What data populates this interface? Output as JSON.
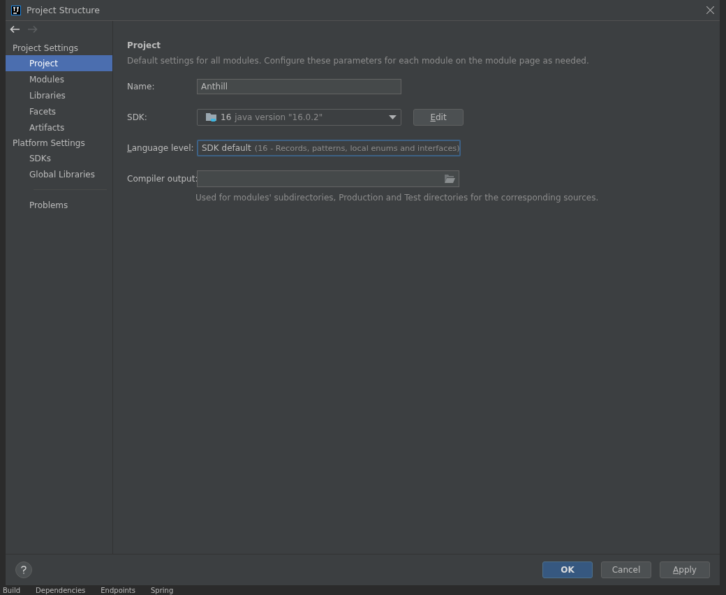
{
  "window": {
    "title": "Project Structure"
  },
  "sidebar": {
    "groups": [
      {
        "heading": "Project Settings",
        "items": [
          {
            "label": "Project",
            "selected": true
          },
          {
            "label": "Modules",
            "selected": false
          },
          {
            "label": "Libraries",
            "selected": false
          },
          {
            "label": "Facets",
            "selected": false
          },
          {
            "label": "Artifacts",
            "selected": false
          }
        ]
      },
      {
        "heading": "Platform Settings",
        "items": [
          {
            "label": "SDKs",
            "selected": false
          },
          {
            "label": "Global Libraries",
            "selected": false
          }
        ]
      }
    ],
    "footer_items": [
      {
        "label": "Problems",
        "selected": false
      }
    ]
  },
  "content": {
    "title": "Project",
    "description": "Default settings for all modules. Configure these parameters for each module on the module page as needed.",
    "name": {
      "label": "Name:",
      "value": "Anthill"
    },
    "sdk": {
      "label": "SDK:",
      "version": "16",
      "detail": "java version \"16.0.2\"",
      "button": "Edit"
    },
    "language_level": {
      "label": "Language level:",
      "value": "SDK default",
      "detail": "(16 - Records, patterns, local enums and interfaces)",
      "focused": true
    },
    "compiler_output": {
      "label": "Compiler output:",
      "hint": "Used for modules' subdirectories, Production and Test directories for the corresponding sources."
    }
  },
  "buttons": [
    {
      "label": "OK",
      "kind": "primary"
    },
    {
      "label": "Cancel",
      "kind": "plain"
    },
    {
      "label": "Apply",
      "kind": "mnemonic"
    }
  ],
  "tool_tabs": [
    "Build",
    "Dependencies",
    "Endpoints",
    "Spring"
  ]
}
